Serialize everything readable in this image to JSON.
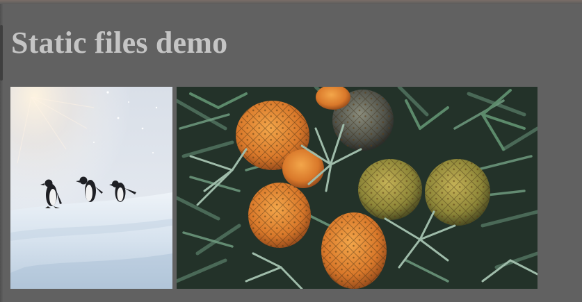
{
  "page": {
    "title": "Static files demo"
  },
  "images": [
    {
      "name": "penguins-image",
      "description_icon": "penguins-photo"
    },
    {
      "name": "pineapples-image",
      "description_icon": "pineapples-photo"
    }
  ],
  "colors": {
    "background": "#616161",
    "heading": "#c5c5c5"
  }
}
